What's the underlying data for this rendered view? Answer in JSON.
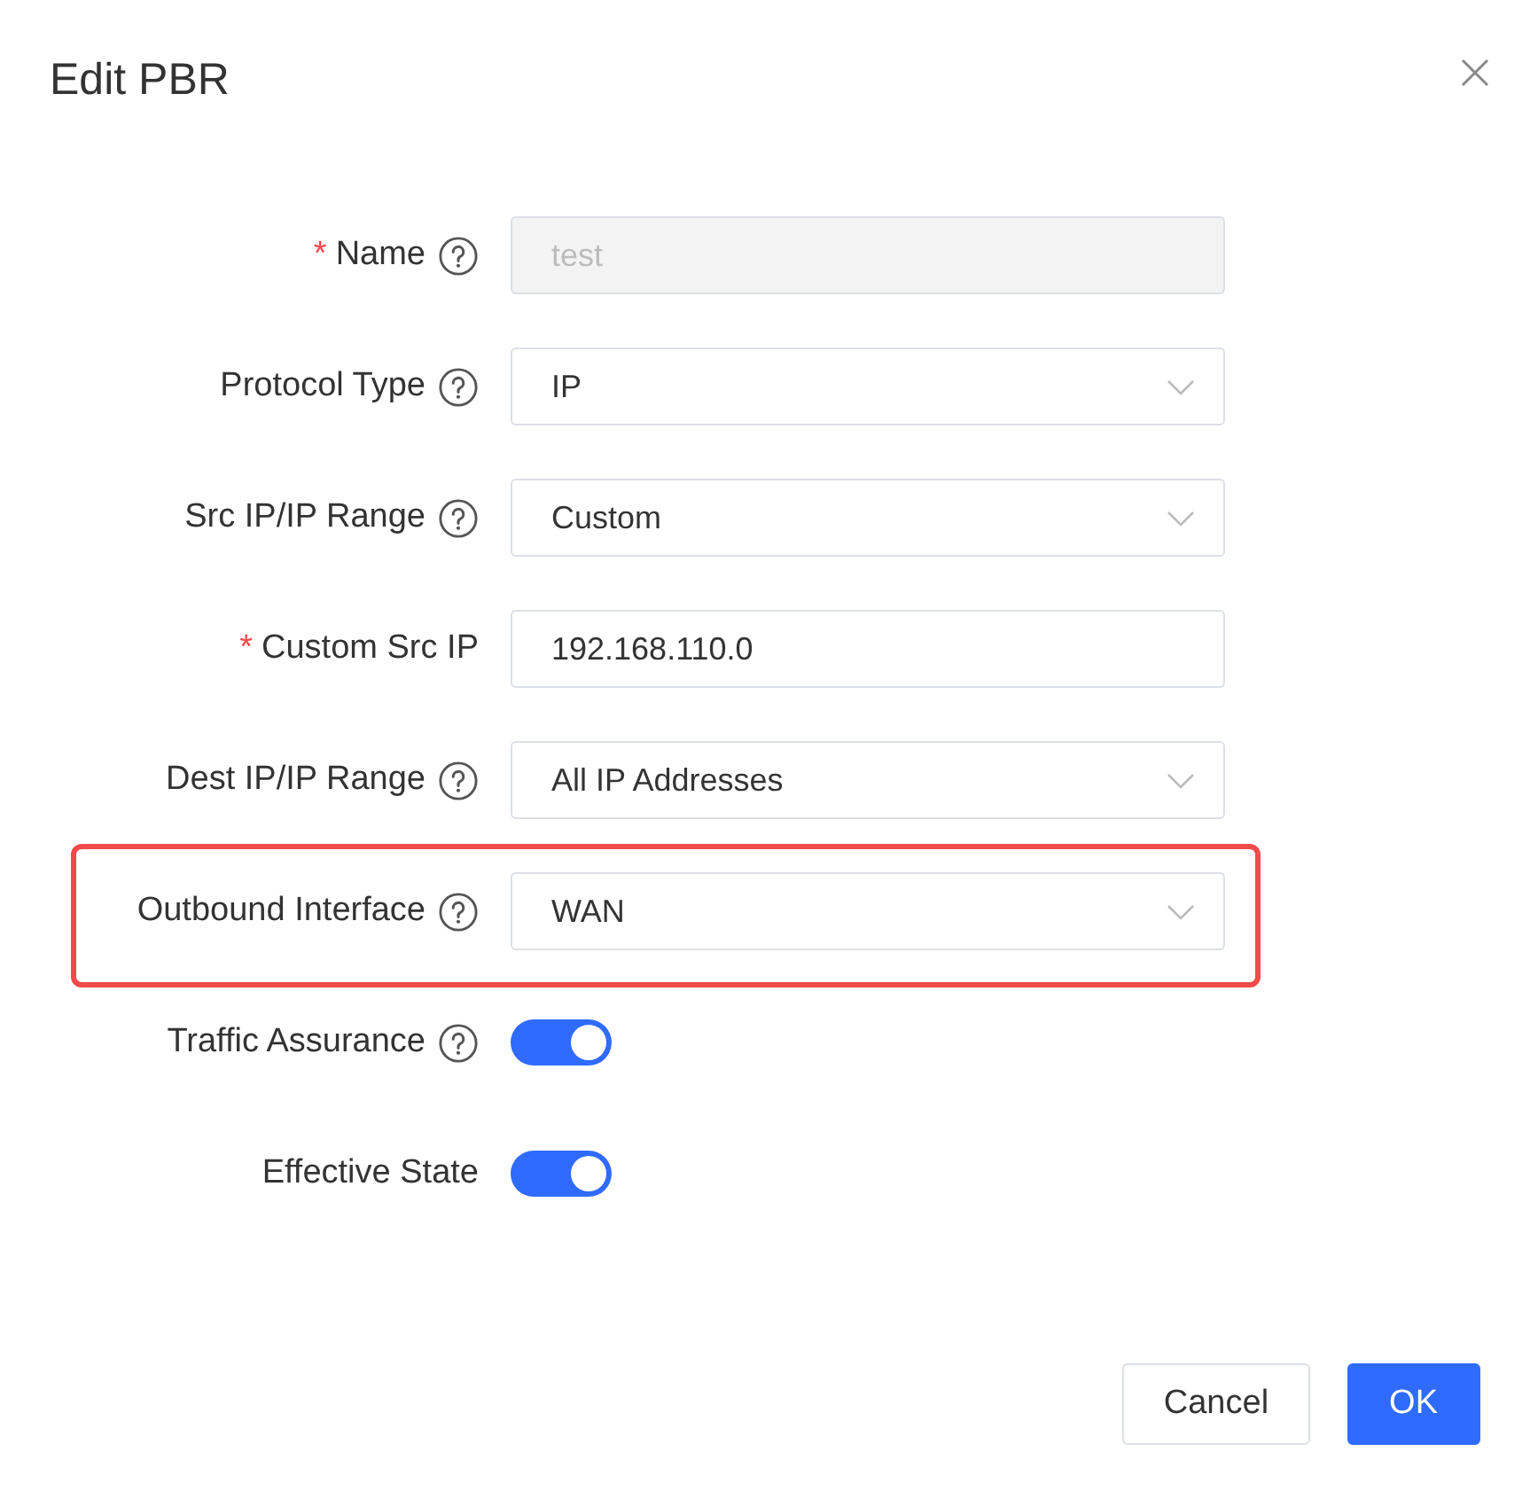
{
  "dialog": {
    "title": "Edit PBR"
  },
  "fields": [
    {
      "kind": "input",
      "required_mark": "*",
      "label": "Name",
      "help": true,
      "value": "test",
      "disabled": true,
      "highlighted": false
    },
    {
      "kind": "select",
      "label": "Protocol Type",
      "help": true,
      "value": "IP",
      "highlighted": false
    },
    {
      "kind": "select",
      "label": "Src IP/IP Range",
      "help": true,
      "value": "Custom",
      "highlighted": false
    },
    {
      "kind": "input",
      "required_mark": "*",
      "label": "Custom Src IP",
      "help": false,
      "value": "192.168.110.0",
      "disabled": false,
      "highlighted": false
    },
    {
      "kind": "select",
      "label": "Dest IP/IP Range",
      "help": true,
      "value": "All IP Addresses",
      "highlighted": false
    },
    {
      "kind": "select",
      "label": "Outbound Interface",
      "help": true,
      "value": "WAN",
      "highlighted": true
    },
    {
      "kind": "switch",
      "label": "Traffic Assurance",
      "help": true,
      "on": true,
      "highlighted": false
    },
    {
      "kind": "switch",
      "label": "Effective State",
      "help": false,
      "on": true,
      "highlighted": false
    }
  ],
  "buttons": [
    {
      "label": "Cancel",
      "primary": false
    },
    {
      "label": "OK",
      "primary": true
    }
  ]
}
